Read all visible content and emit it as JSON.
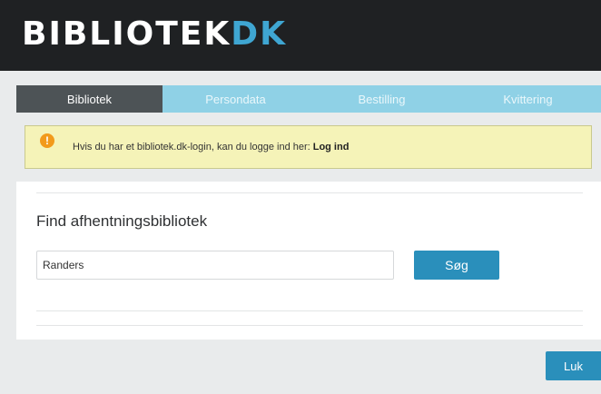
{
  "header": {
    "logo_main": "BIBLIOTEK",
    "logo_suffix": "DK"
  },
  "steps": [
    {
      "label": "Bibliotek",
      "active": true
    },
    {
      "label": "Persondata",
      "active": false
    },
    {
      "label": "Bestilling",
      "active": false
    },
    {
      "label": "Kvittering",
      "active": false
    }
  ],
  "notice": {
    "icon": "exclamation-circle-icon",
    "icon_glyph": "!",
    "icon_color": "#f29a1b",
    "text": "Hvis du har et bibliotek.dk-login, kan du logge ind her:",
    "link": "Log ind"
  },
  "search": {
    "title": "Find afhentningsbibliotek",
    "value": "Randers",
    "button_label": "Søg"
  },
  "footer": {
    "close_label": "Luk"
  },
  "colors": {
    "header_bg": "#1f2123",
    "logo_accent": "#3fa6d2",
    "step_active": "#4d5356",
    "step_inactive": "#8fd1e6",
    "notice_bg": "#f5f3b8",
    "button": "#2a8fbb"
  }
}
